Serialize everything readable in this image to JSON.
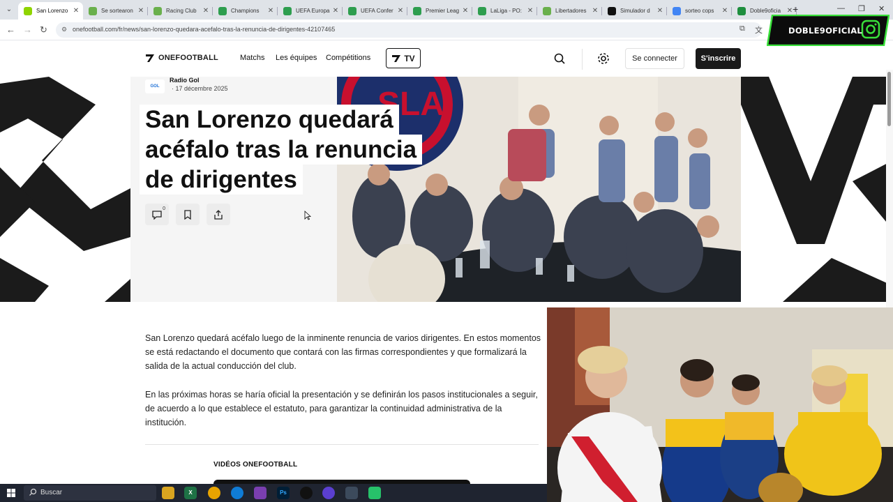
{
  "browser": {
    "tabs": [
      {
        "label": "San Lorenzo",
        "favicon_color": "#8fd400",
        "active": true
      },
      {
        "label": "Se sortearon",
        "favicon_color": "#6ab04c"
      },
      {
        "label": "Racing Club",
        "favicon_color": "#6ab04c"
      },
      {
        "label": "Champions",
        "favicon_color": "#2e9e4f"
      },
      {
        "label": "UEFA Europa",
        "favicon_color": "#2e9e4f"
      },
      {
        "label": "UEFA Confer",
        "favicon_color": "#2e9e4f"
      },
      {
        "label": "Premier Leag",
        "favicon_color": "#2e9e4f"
      },
      {
        "label": "LaLiga - PO:",
        "favicon_color": "#2e9e4f"
      },
      {
        "label": "Libertadores",
        "favicon_color": "#6ab04c"
      },
      {
        "label": "Simulador d",
        "favicon_color": "#111111"
      },
      {
        "label": "sorteo cops",
        "favicon_color": "#4285f4"
      },
      {
        "label": "Doble9oficia",
        "favicon_color": "#1e8e3e"
      }
    ],
    "new_tab_glyph": "+",
    "url": "onefootball.com/fr/news/san-lorenzo-quedara-acefalo-tras-la-renuncia-de-dirigentes-42107465"
  },
  "site_header": {
    "logo_text": "ONEFOOTBALL",
    "nav": [
      "Matchs",
      "Les équipes",
      "Compétitions"
    ],
    "tv_label": "TV",
    "login_label": "Se connecter",
    "signup_label": "S'inscrire"
  },
  "article": {
    "source_name": "Radio Gol",
    "source_logo_text": "GOL",
    "date": "· 17 décembre 2025",
    "headline_lines": [
      "San Lorenzo quedará",
      "acéfalo tras la renuncia",
      "de dirigentes"
    ],
    "comment_count": "0",
    "paragraphs": [
      "San Lorenzo quedará acéfalo luego de la inminente renuncia de varios dirigentes. En estos momentos se está redactando el documento que contará con las firmas correspondientes y que formalizará la salida de la actual conducción del club.",
      "En las próximas horas se haría oficial la presentación y se definirán los pasos institucionales a seguir, de acuerdo a lo que establece el estatuto, para garantizar la continuidad administrativa de la institución."
    ],
    "videos_title": "VIDÉOS ONEFOOTBALL",
    "photo_crest_text": "CASLA"
  },
  "overlay": {
    "brand_text": "DOBLE9OFICIAL",
    "brand_color": "#39e03a"
  },
  "taskbar": {
    "search_placeholder": "Buscar"
  },
  "colors": {
    "accent_dark": "#1a1a1a",
    "hero_bg": "#f5f5f5"
  }
}
